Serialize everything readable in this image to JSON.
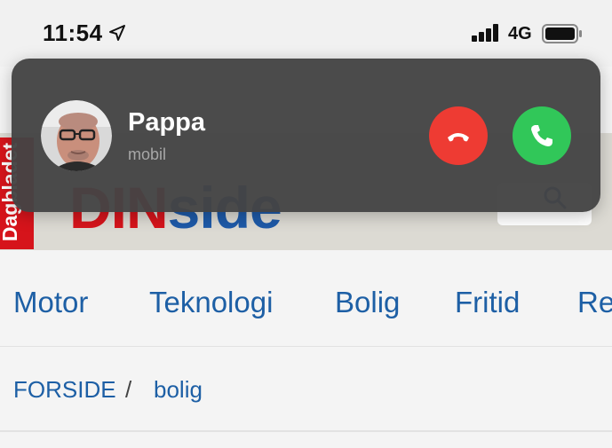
{
  "status_bar": {
    "time": "11:54",
    "network": "4G",
    "icons": [
      "location-arrow-icon",
      "signal-icon",
      "battery-icon"
    ]
  },
  "site": {
    "logo_text": "Dagbladet",
    "title_part1": "DIN",
    "title_part2": "side",
    "brand_red": "#d6141b",
    "brand_blue": "#1e5aa8"
  },
  "call": {
    "caller_name": "Pappa",
    "caller_type": "mobil",
    "decline_color": "#ee3b33",
    "accept_color": "#31c759",
    "icons": [
      "phone-hangup-icon",
      "phone-icon"
    ]
  },
  "nav": {
    "items": [
      {
        "label": "Motor"
      },
      {
        "label": "Teknologi"
      },
      {
        "label": "Bolig"
      },
      {
        "label": "Fritid"
      },
      {
        "label": "Re"
      }
    ]
  },
  "breadcrumb": {
    "home": "FORSIDE",
    "separator": "/",
    "current": "bolig"
  }
}
